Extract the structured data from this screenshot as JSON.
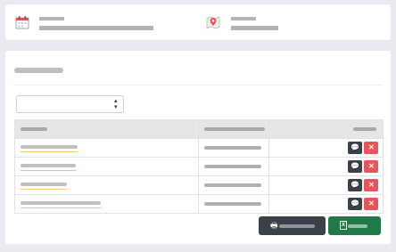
{
  "info_card": {
    "calendar_block": {
      "icon": "calendar-icon",
      "title": "",
      "subtitle": ""
    },
    "map_block": {
      "icon": "map-pin-icon",
      "title": "",
      "subtitle": ""
    }
  },
  "main_card": {
    "header": "",
    "select": {
      "value": ""
    },
    "table": {
      "columns": [
        "",
        "",
        ""
      ],
      "rows": [
        {
          "name": "",
          "value": ""
        },
        {
          "name": "",
          "value": ""
        },
        {
          "name": "",
          "value": ""
        },
        {
          "name": "",
          "value": ""
        }
      ],
      "row_actions": {
        "comment_icon": "comment-icon",
        "delete_icon": "close-icon"
      }
    },
    "buttons": {
      "print": {
        "icon": "printer-icon",
        "label": ""
      },
      "excel": {
        "icon": "excel-file-icon",
        "label": ""
      }
    }
  },
  "colors": {
    "background": "#e9ebf0",
    "dark_button": "#3a4149",
    "delete_button": "#e9545b",
    "excel_button": "#1f7a47",
    "link_underline": "#f3c77a",
    "table_header": "#e6e6e6"
  }
}
